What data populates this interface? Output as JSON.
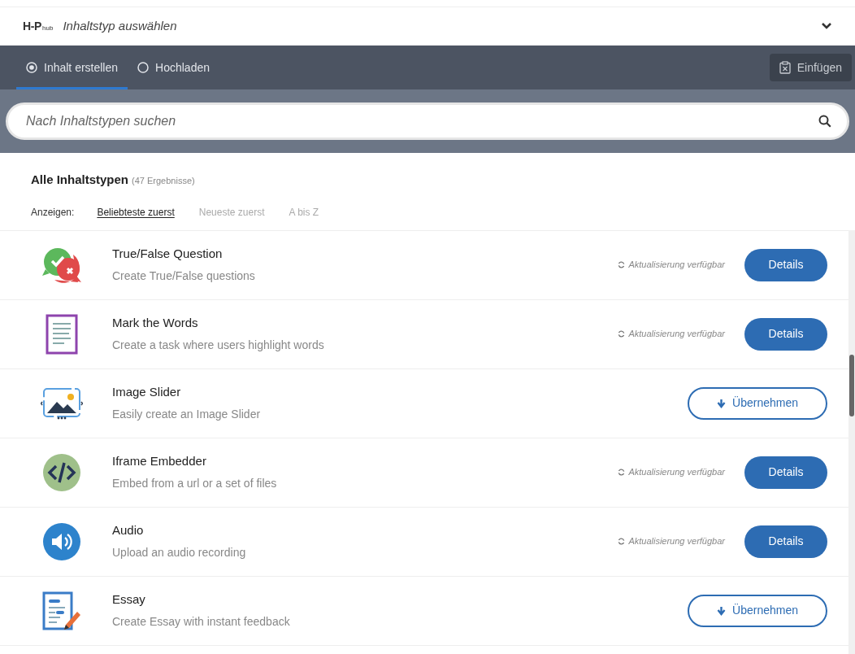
{
  "header": {
    "logo": "H-P",
    "logo_suffix": "hub",
    "title": "Inhaltstyp auswählen"
  },
  "tabs": [
    {
      "label": "Inhalt erstellen",
      "selected": true
    },
    {
      "label": "Hochladen",
      "selected": false
    }
  ],
  "paste_button": "Einfügen",
  "search": {
    "placeholder": "Nach Inhaltstypen suchen"
  },
  "list_heading": {
    "title": "Alle Inhaltstypen",
    "count": "(47 Ergebnisse)"
  },
  "sort": {
    "label": "Anzeigen:",
    "options": [
      {
        "label": "Beliebteste zuerst",
        "selected": true
      },
      {
        "label": "Neueste zuerst",
        "selected": false
      },
      {
        "label": "A bis Z",
        "selected": false
      }
    ]
  },
  "items": [
    {
      "title": "True/False Question",
      "description": "Create True/False questions",
      "kind": "update",
      "note": "Aktualisierung verfügbar",
      "button": "Details"
    },
    {
      "title": "Mark the Words",
      "description": "Create a task where users highlight words",
      "kind": "update",
      "note": "Aktualisierung verfügbar",
      "button": "Details"
    },
    {
      "title": "Image Slider",
      "description": "Easily create an Image Slider",
      "kind": "install",
      "button": "Übernehmen"
    },
    {
      "title": "Iframe Embedder",
      "description": "Embed from a url or a set of files",
      "kind": "update",
      "note": "Aktualisierung verfügbar",
      "button": "Details"
    },
    {
      "title": "Audio",
      "description": "Upload an audio recording",
      "kind": "update",
      "note": "Aktualisierung verfügbar",
      "button": "Details"
    },
    {
      "title": "Essay",
      "description": "Create Essay with instant feedback",
      "kind": "install",
      "button": "Übernehmen"
    }
  ]
}
